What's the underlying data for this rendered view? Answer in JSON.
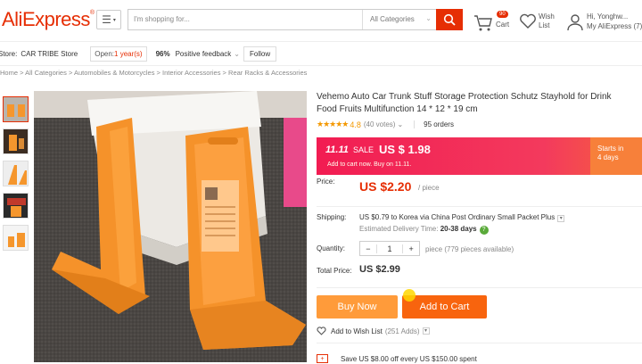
{
  "header": {
    "logo": "AliExpress",
    "logo_reg": "®",
    "search_placeholder": "I'm shopping for...",
    "search_category": "All Categories",
    "cart_count": "90",
    "cart_label": "Cart",
    "wish_line1": "Wish",
    "wish_line2": "List",
    "user_line1": "Hi, Yonghw...",
    "user_line2": "My AliExpress (7)"
  },
  "store": {
    "prefix": "Store:",
    "name": "CAR TRIBE Store",
    "open_label": "Open:",
    "open_value": "1 year(s)",
    "feedback_pct": "96%",
    "feedback_label": "Positive feedback",
    "follow": "Follow"
  },
  "breadcrumb": [
    "Home",
    "All Categories",
    "Automobiles & Motorcycles",
    "Interior Accessories",
    "Rear Racks & Accessories"
  ],
  "product": {
    "title": "Vehemo Auto Car Trunk Stuff Storage Protection Schutz Stayhold for Drink Food Fruits Multifunction 14 * 12 * 19 cm",
    "stars": "★★★★★",
    "rating": "4.8",
    "votes": "(40 votes)",
    "orders": "95 orders",
    "sale_tag": "11.11",
    "sale_word": "SALE",
    "sale_price": "US $ 1.98",
    "sale_sub": "Add to cart now. Buy on 11.11.",
    "starts_line1": "Starts in",
    "starts_line2": "4 days",
    "price_label": "Price:",
    "price": "US $2.20",
    "price_unit": "/ piece",
    "shipping_label": "Shipping:",
    "shipping_text": "US $0.79 to Korea via China Post Ordinary Small Packet Plus",
    "delivery_label": "Estimated Delivery Time:",
    "delivery_days": "20-38 days",
    "quantity_label": "Quantity:",
    "quantity_minus": "−",
    "quantity_value": "1",
    "quantity_plus": "+",
    "quantity_hint": "piece (779 pieces available)",
    "total_label": "Total Price:",
    "total": "US $2.99",
    "buy_now": "Buy Now",
    "add_to_cart": "Add to Cart",
    "wishlist_label": "Add to Wish List",
    "wishlist_count": "(251 Adds)",
    "coupon_text": "Save US $8.00 off every US $150.00 spent"
  },
  "colors": {
    "brand": "#e62e04",
    "buy_now": "#ff9b3a",
    "add_to_cart": "#f8640e",
    "sale_banner": "#f21c52"
  }
}
